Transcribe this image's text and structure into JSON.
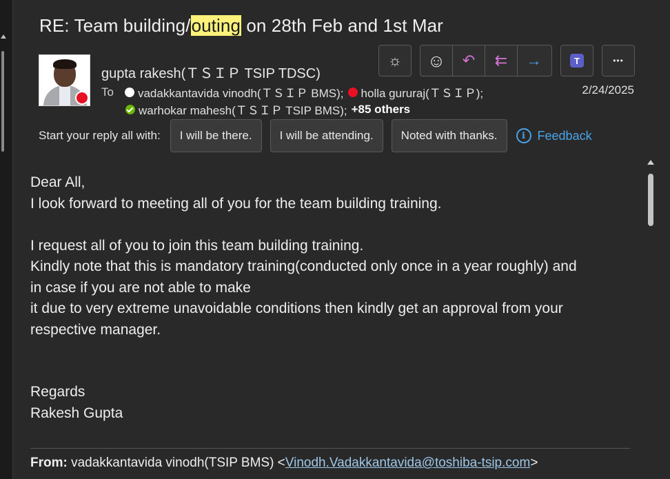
{
  "subject": {
    "before": "RE: Team building/",
    "highlight": "outing",
    "after": " on 28th Feb and 1st Mar"
  },
  "sender": {
    "name": "gupta rakesh(ＴＳＩＰ TSIP TDSC)",
    "presence_color": "#e81123"
  },
  "recipients": {
    "to_label": "To",
    "list": [
      {
        "name": "vadakkantavida vinodh(ＴＳＩＰ BMS);",
        "presence": "white"
      },
      {
        "name": "holla gururaj(ＴＳＩＰ);",
        "presence": "red"
      },
      {
        "name": "warhokar mahesh(ＴＳＩＰ TSIP BMS);",
        "presence": "green"
      }
    ],
    "others": "+85 others"
  },
  "date": "2/24/2025",
  "actions": [
    {
      "name": "brightness-icon",
      "glyph": "☼"
    },
    {
      "name": "emoji-icon",
      "glyph": "☺"
    },
    {
      "name": "reply-icon",
      "glyph": "↶"
    },
    {
      "name": "reply-all-icon",
      "glyph": "⇇"
    },
    {
      "name": "forward-icon",
      "glyph": "→"
    },
    {
      "name": "teams-icon",
      "glyph": "T"
    },
    {
      "name": "more-icon",
      "glyph": "•••"
    }
  ],
  "reply_bar": {
    "label": "Start your reply all with:",
    "suggestions": [
      "I will be there.",
      "I will be attending.",
      "Noted with thanks."
    ],
    "feedback": "Feedback"
  },
  "body": {
    "l1": "Dear All,",
    "l2": "I look forward to meeting all of you for the team building training.",
    "l3": "I request all of you to join this team building training.",
    "l4": "Kindly note that this is mandatory training(conducted only once in a year roughly) and",
    "l5": "in case if you are not able to make",
    "l6": "it due to very extreme unavoidable conditions then kindly get an approval from your",
    "l7": "respective manager.",
    "l8": "Regards",
    "l9": "Rakesh Gupta"
  },
  "quoted": {
    "from_label": "From:",
    "from_name": " vadakkantavida vinodh(TSIP BMS) <",
    "email": "Vinodh.Vadakkantavida@toshiba-tsip.com",
    "close": ">"
  },
  "colors": {
    "accent": "#4aa3e8",
    "highlight": "#fff27a",
    "reply_icon": "#d374d3",
    "forward_icon": "#4aa3e8",
    "teams": "#5b5fc7"
  }
}
